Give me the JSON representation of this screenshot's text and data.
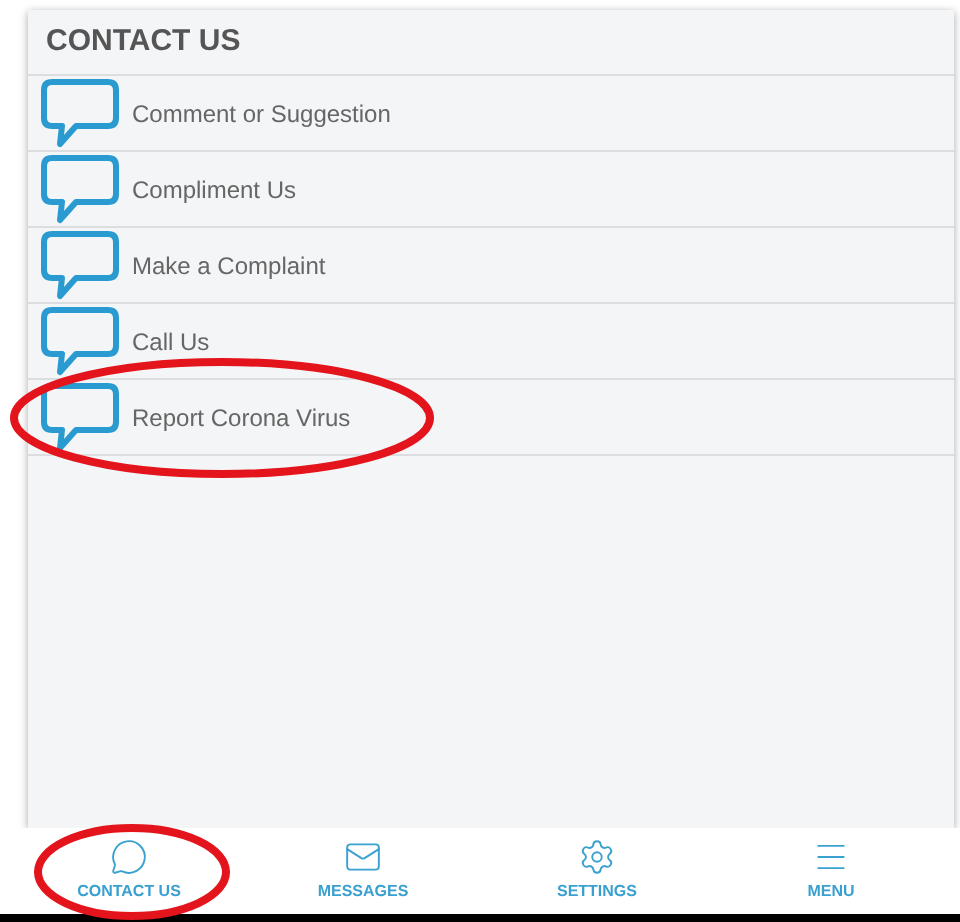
{
  "header": {
    "title": "CONTACT US"
  },
  "items": [
    {
      "label": "Comment or Suggestion"
    },
    {
      "label": "Compliment Us"
    },
    {
      "label": "Make a Complaint"
    },
    {
      "label": "Call Us"
    },
    {
      "label": "Report Corona Virus"
    }
  ],
  "bottom_nav": [
    {
      "label": "CONTACT US",
      "kind": "chat"
    },
    {
      "label": "MESSAGES",
      "kind": "mail"
    },
    {
      "label": "SETTINGS",
      "kind": "gear"
    },
    {
      "label": "MENU",
      "kind": "menu"
    }
  ]
}
